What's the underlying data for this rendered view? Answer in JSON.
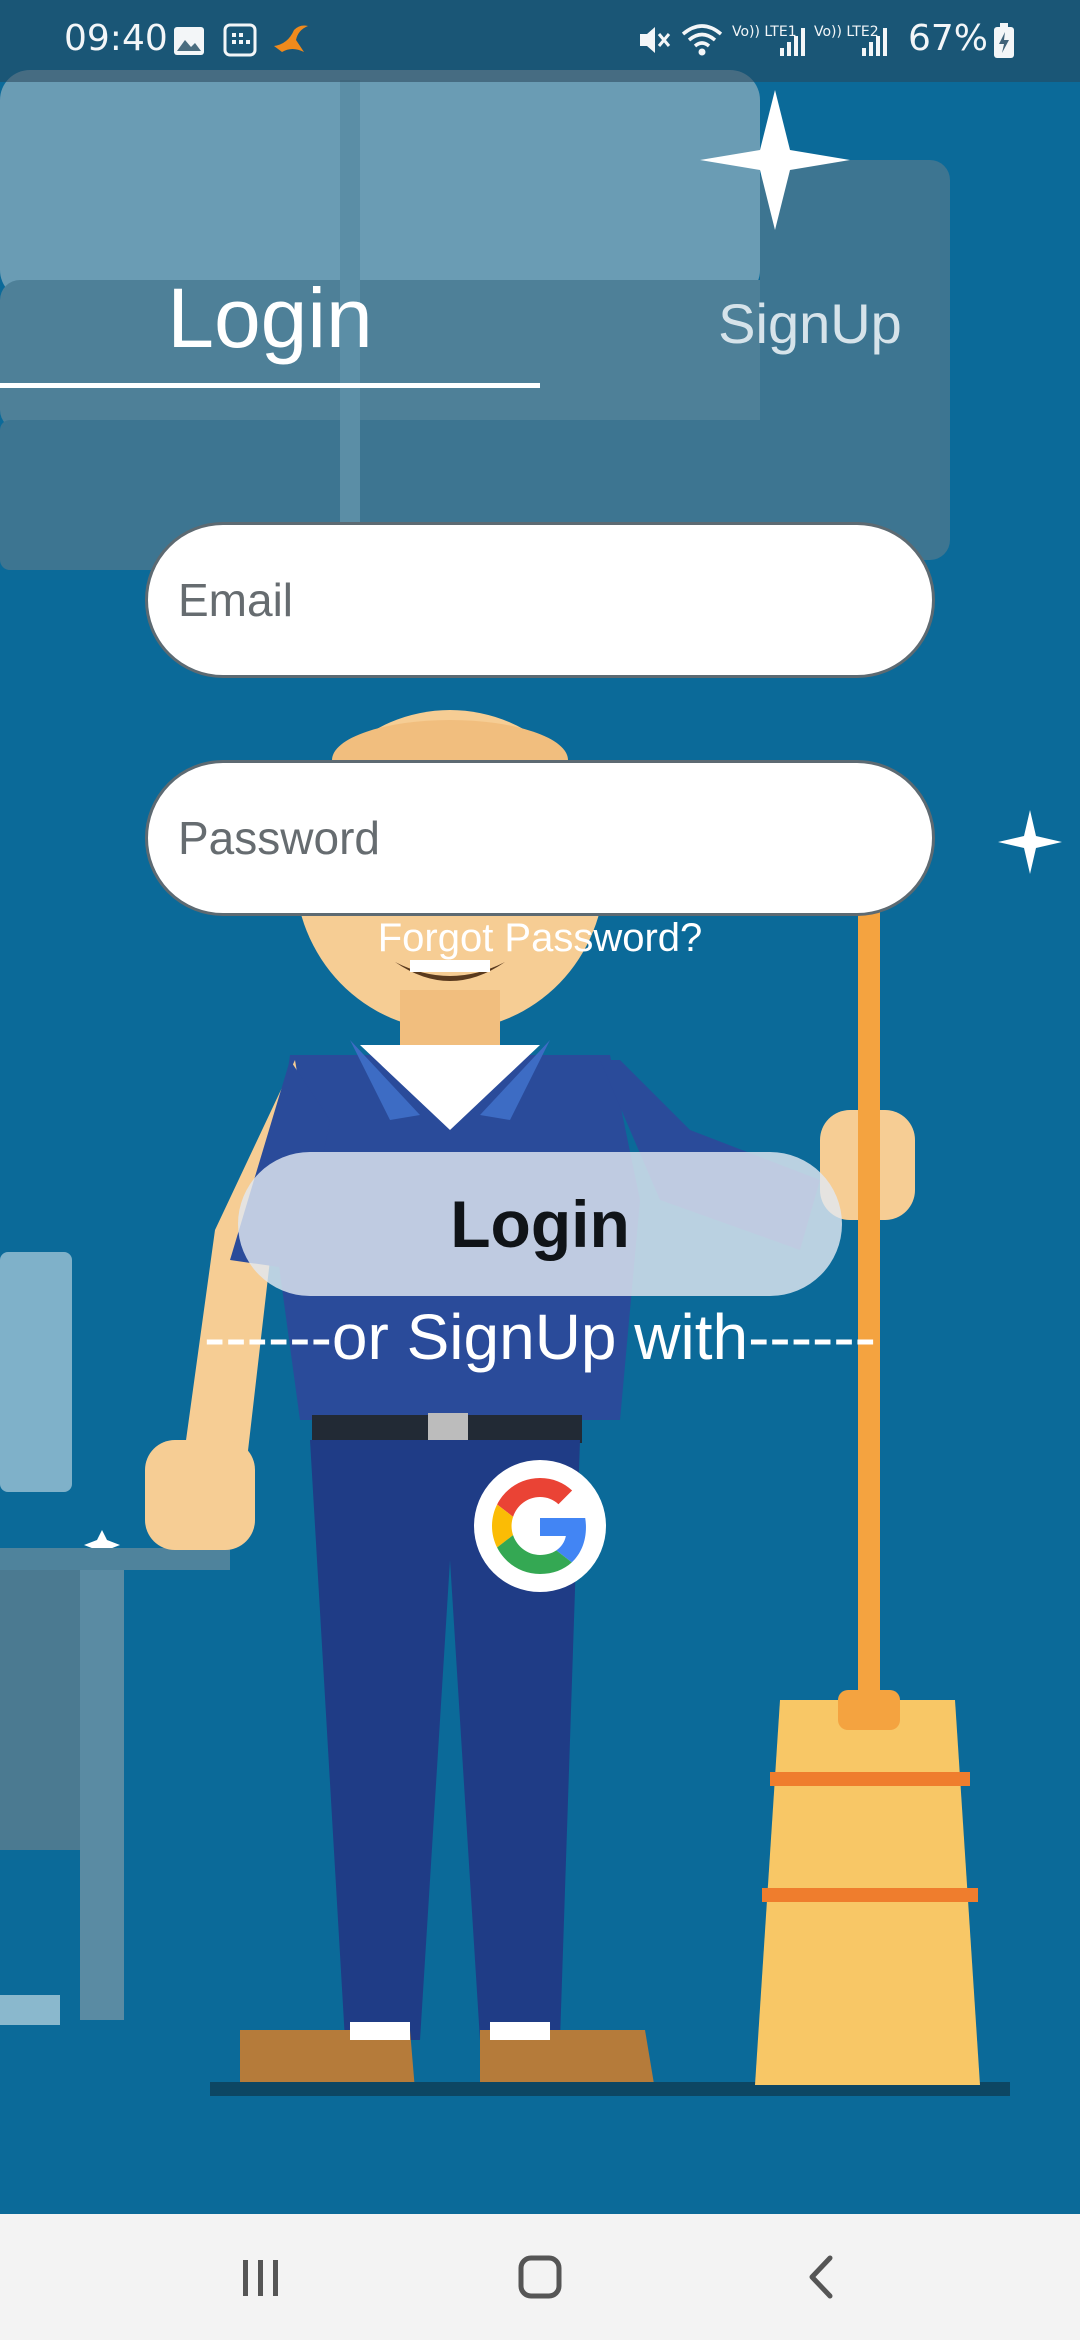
{
  "status_bar": {
    "time": "09:40",
    "battery": "67%",
    "icons": [
      "gallery-icon",
      "calendar-icon",
      "app-notification-icon",
      "mute-icon",
      "wifi-icon",
      "lte1-signal-icon",
      "lte2-signal-icon",
      "battery-charging-icon"
    ],
    "sim1_label": "Vo)) LTE1",
    "sim2_label": "Vo)) LTE2"
  },
  "tabs": {
    "login_label": "Login",
    "signup_label": "SignUp",
    "active": "login"
  },
  "form": {
    "email_placeholder": "Email",
    "email_value": "",
    "password_placeholder": "Password",
    "password_value": "",
    "forgot_label": "Forgot Password?",
    "login_button_label": "Login",
    "or_signup_text": "------or SignUp with------",
    "google_icon": "google-g-icon"
  },
  "nav": {
    "icons": [
      "recent-apps-icon",
      "home-icon",
      "back-icon"
    ]
  },
  "colors": {
    "background": "#0b6a99",
    "accent_white": "#ffffff",
    "login_button_bg": "#e1e8f0",
    "nav_bar_bg": "#f3f3f3"
  }
}
